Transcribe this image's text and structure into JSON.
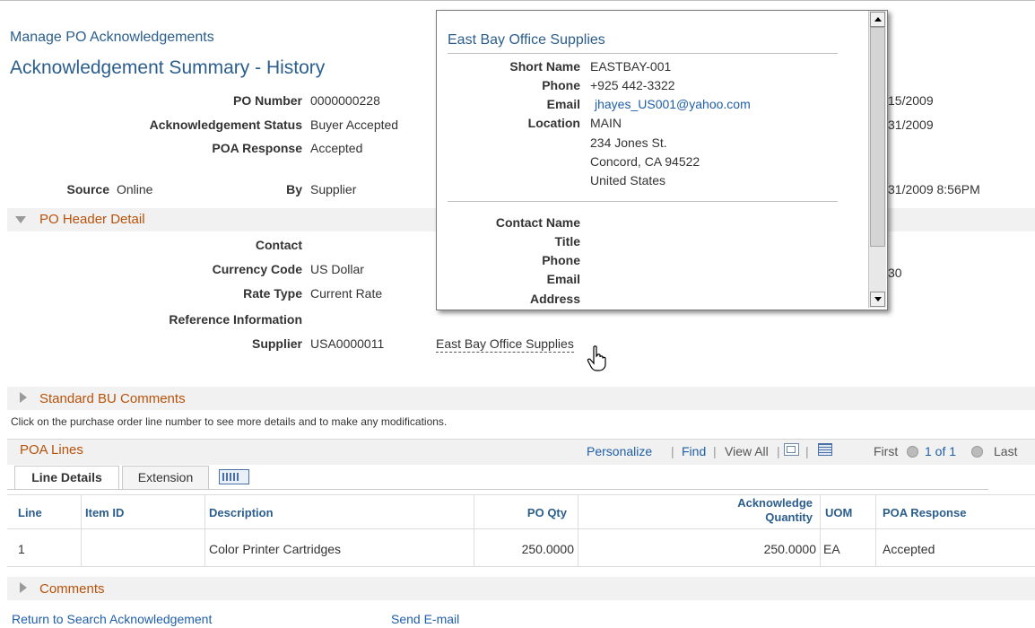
{
  "breadcrumb": "Manage PO Acknowledgements",
  "title": "Acknowledgement Summary - History",
  "summary": {
    "po_number_label": "PO Number",
    "po_number": "0000000228",
    "ack_status_label": "Acknowledgement Status",
    "ack_status": "Buyer Accepted",
    "poa_response_label": "POA Response",
    "poa_response": "Accepted",
    "source_label": "Source",
    "source": "Online",
    "by_label": "By",
    "by": "Supplier",
    "right_date_1": "15/2009",
    "right_date_2": "31/2009",
    "right_date_3": "31/2009 8:56PM"
  },
  "po_header": {
    "title": "PO Header Detail",
    "contact_label": "Contact",
    "currency_label": "Currency Code",
    "currency": "US Dollar",
    "rate_type_label": "Rate Type",
    "rate_type": "Current Rate",
    "reference_label": "Reference Information",
    "supplier_label": "Supplier",
    "supplier_id": "USA0000011",
    "supplier_name": "East Bay Office Supplies",
    "right_value": "30"
  },
  "standard_bu": {
    "title": "Standard BU Comments"
  },
  "instruction": "Click on the purchase order line number to see more details and to make any modifications.",
  "poa_lines": {
    "title": "POA Lines",
    "personalize": "Personalize",
    "find": "Find",
    "view_all": "View All",
    "sep": "|",
    "first": "First",
    "count": "1 of 1",
    "last": "Last",
    "tabs": [
      "Line Details",
      "Extension"
    ],
    "columns": {
      "line": "Line",
      "item_id": "Item ID",
      "description": "Description",
      "po_qty": "PO Qty",
      "ack_qty_1": "Acknowledge",
      "ack_qty_2": "Quantity",
      "uom": "UOM",
      "poa_response": "POA Response"
    },
    "rows": [
      {
        "line": "1",
        "item_id": "",
        "description": "Color Printer Cartridges",
        "po_qty": "250.0000",
        "ack_qty": "250.0000",
        "uom": "EA",
        "poa_response": "Accepted"
      }
    ]
  },
  "comments": {
    "title": "Comments"
  },
  "footer": {
    "return_link": "Return to Search Acknowledgement",
    "send_email": "Send E-mail"
  },
  "popup": {
    "title": "East Bay Office Supplies",
    "short_name_label": "Short Name",
    "short_name": "EASTBAY-001",
    "phone_label": "Phone",
    "phone": "+925 442-3322",
    "email_label": "Email",
    "email": "jhayes_US001@yahoo.com",
    "location_label": "Location",
    "location_lines": [
      "MAIN",
      "234 Jones St.",
      "Concord, CA  94522",
      "United States"
    ],
    "contact_name_label": "Contact Name",
    "title_label": "Title",
    "contact_phone_label": "Phone",
    "contact_email_label": "Email",
    "address_label": "Address"
  },
  "icons": {
    "collapse": "triangle-down-icon",
    "expand": "triangle-right-icon",
    "zoom": "new-window-icon",
    "download": "grid-download-icon",
    "show_all_columns": "show-all-columns-icon",
    "prev": "previous-arrow-icon",
    "next": "next-arrow-icon",
    "cursor": "hand-cursor-icon"
  },
  "colors": {
    "link": "#1f5ea8",
    "title": "#2b5e8d",
    "section_title": "#b8520a",
    "band": "#f1f1f1"
  }
}
